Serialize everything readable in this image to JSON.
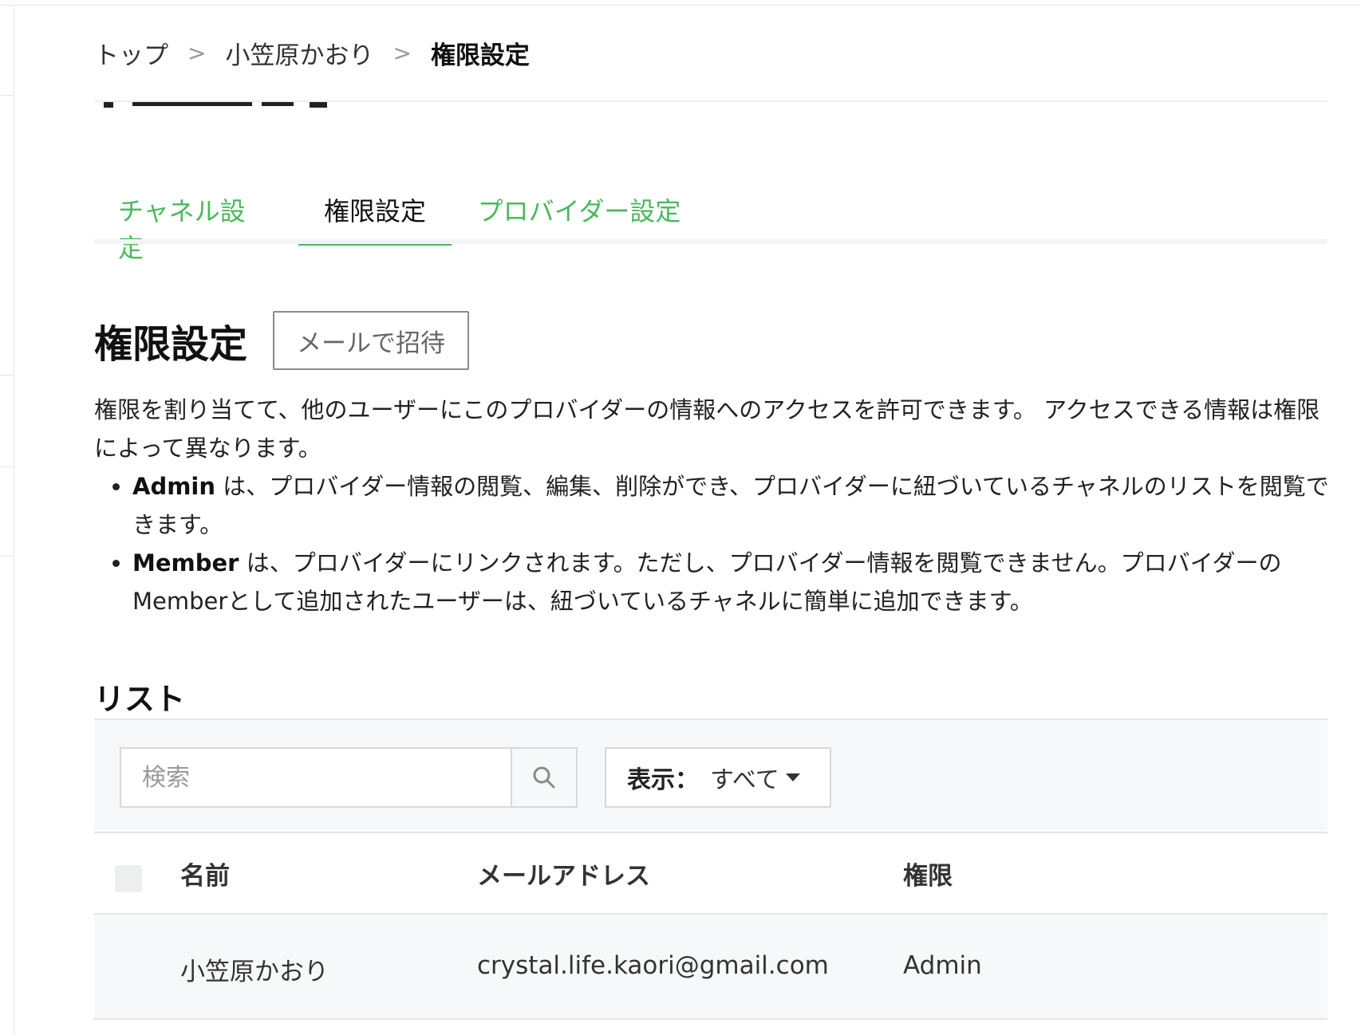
{
  "breadcrumb": {
    "items": [
      "トップ",
      "小笠原かおり",
      "権限設定"
    ],
    "separator": ">"
  },
  "tabs": [
    {
      "label": "チャネル設定",
      "active": false
    },
    {
      "label": "権限設定",
      "active": true
    },
    {
      "label": "プロバイダー設定",
      "active": false
    }
  ],
  "section": {
    "title": "権限設定",
    "invite_label": "メールで招待"
  },
  "description": {
    "intro": "権限を割り当てて、他のユーザーにこのプロバイダーの情報へのアクセスを許可できます。 アクセスできる情報は権限によって異なります。",
    "bullets": [
      {
        "role": "Admin",
        "text": " は、プロバイダー情報の閲覧、編集、削除ができ、プロバイダーに紐づいているチャネルのリストを閲覧できます。"
      },
      {
        "role": "Member",
        "text": " は、プロバイダーにリンクされます。ただし、プロバイダー情報を閲覧できません。プロバイダーのMemberとして追加されたユーザーは、紐づいているチャネルに簡単に追加できます。"
      }
    ]
  },
  "list": {
    "title": "リスト",
    "search_placeholder": "検索",
    "search_icon": "search-icon",
    "filter_key": "表示：",
    "filter_value": "すべて",
    "columns": [
      "名前",
      "メールアドレス",
      "権限"
    ],
    "rows": [
      {
        "name": "小笠原かおり",
        "email": "crystal.life.kaori@gmail.com",
        "role": "Admin"
      }
    ]
  },
  "colors": {
    "accent": "#4cb85c",
    "text": "#1a1a1a",
    "muted": "#9a9a9a",
    "panel": "#f7f8f9"
  }
}
